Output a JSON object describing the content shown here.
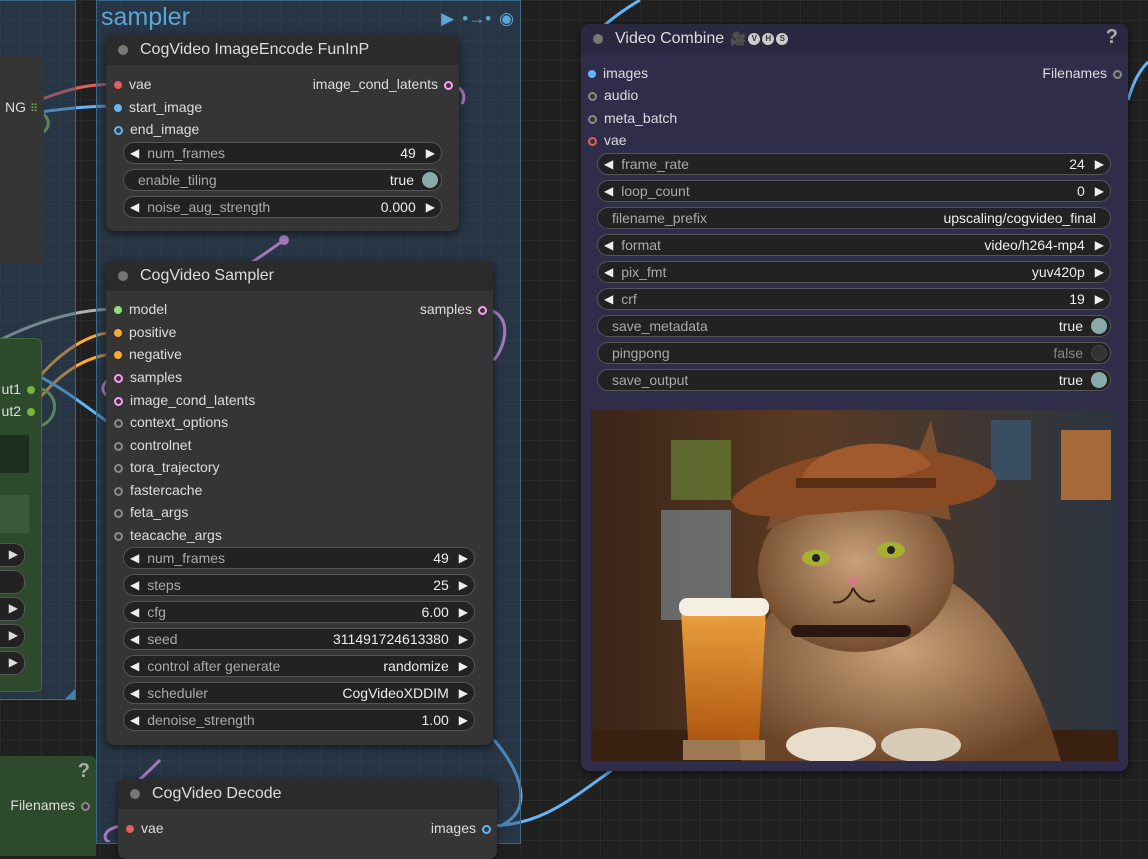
{
  "groups": {
    "sampler": {
      "title": "sampler"
    }
  },
  "left_partial": {
    "encode_output": "NG",
    "outputs": [
      "ut1",
      "ut2"
    ],
    "lower_node_output": "Filenames"
  },
  "image_encode": {
    "title": "CogVideo ImageEncode FunInP",
    "inputs": [
      "vae",
      "start_image",
      "end_image"
    ],
    "output": "image_cond_latents",
    "widgets": {
      "num_frames": {
        "label": "num_frames",
        "value": "49"
      },
      "enable_tiling": {
        "label": "enable_tiling",
        "value": "true"
      },
      "noise_aug_strength": {
        "label": "noise_aug_strength",
        "value": "0.000"
      }
    }
  },
  "sampler": {
    "title": "CogVideo Sampler",
    "inputs": [
      "model",
      "positive",
      "negative",
      "samples",
      "image_cond_latents",
      "context_options",
      "controlnet",
      "tora_trajectory",
      "fastercache",
      "feta_args",
      "teacache_args"
    ],
    "output": "samples",
    "widgets": [
      {
        "label": "num_frames",
        "value": "49"
      },
      {
        "label": "steps",
        "value": "25"
      },
      {
        "label": "cfg",
        "value": "6.00"
      },
      {
        "label": "seed",
        "value": "311491724613380"
      },
      {
        "label": "control after generate",
        "value": "randomize"
      },
      {
        "label": "scheduler",
        "value": "CogVideoXDDIM"
      },
      {
        "label": "denoise_strength",
        "value": "1.00"
      }
    ]
  },
  "decode": {
    "title": "CogVideo Decode",
    "input": "vae",
    "output": "images"
  },
  "video_combine": {
    "title": "Video Combine",
    "badges": [
      "V",
      "H",
      "S"
    ],
    "help": "?",
    "inputs": [
      "images",
      "audio",
      "meta_batch",
      "vae"
    ],
    "output": "Filenames",
    "widgets": {
      "frame_rate": {
        "label": "frame_rate",
        "value": "24"
      },
      "loop_count": {
        "label": "loop_count",
        "value": "0"
      },
      "filename_prefix": {
        "label": "filename_prefix",
        "value": "upscaling/cogvideo_final"
      },
      "format": {
        "label": "format",
        "value": "video/h264-mp4"
      },
      "pix_fmt": {
        "label": "pix_fmt",
        "value": "yuv420p"
      },
      "crf": {
        "label": "crf",
        "value": "19"
      },
      "save_metadata": {
        "label": "save_metadata",
        "value": "true"
      },
      "pingpong": {
        "label": "pingpong",
        "value": "false"
      },
      "save_output": {
        "label": "save_output",
        "value": "true"
      }
    }
  },
  "help_icon": "?",
  "colors": {
    "vae": "#e06060",
    "image": "#64b5f6",
    "latent": "#ff9cf9",
    "model": "#b39ddb",
    "conditioning": "#ffa931",
    "other": "#8a8a8a",
    "green": "#7cb342"
  },
  "icons": [
    "play-icon",
    "connect-icon",
    "eye-icon",
    "film-icon",
    "help-icon",
    "arrow-left-icon",
    "arrow-right-icon",
    "grid-icon"
  ]
}
